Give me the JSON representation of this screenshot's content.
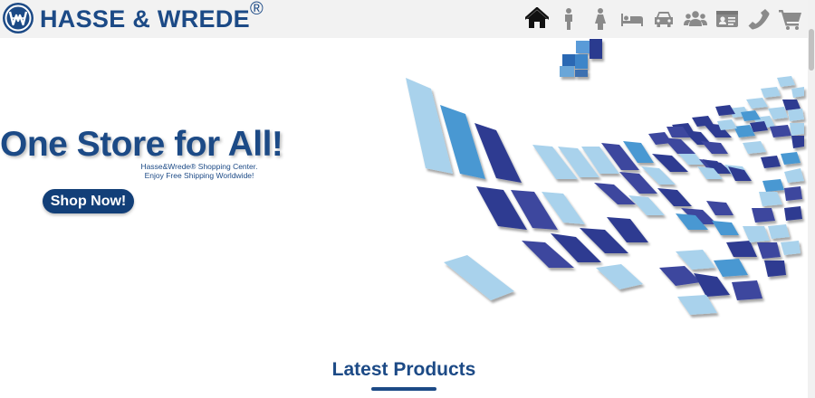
{
  "brand": {
    "name": "HASSE & WREDE",
    "registered_mark": "®",
    "primary_color": "#1c4a86",
    "button_color": "#123f78"
  },
  "nav": {
    "icons": [
      "home-icon",
      "male-icon",
      "female-icon",
      "bed-icon",
      "car-icon",
      "users-icon",
      "id-card-icon",
      "phone-icon",
      "cart-icon"
    ],
    "active": "home-icon"
  },
  "hero": {
    "title": "One Store for All!",
    "subtitle_line1": "Hasse&Wrede® Shopping Center.",
    "subtitle_line2": "Enjoy Free Shipping Worldwide!",
    "cta_label": "Shop Now!"
  },
  "sections": {
    "latest_products_title": "Latest Products"
  }
}
